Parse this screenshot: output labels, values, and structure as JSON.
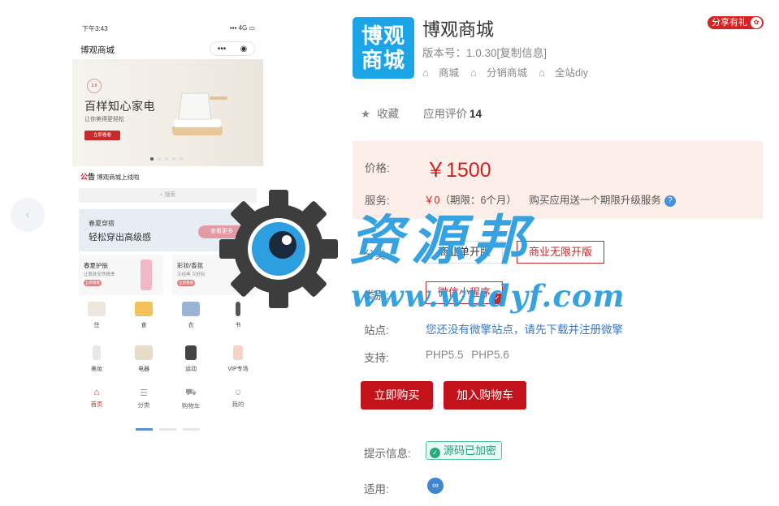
{
  "preview": {
    "status_time": "下午3:43",
    "status_signal": "4G",
    "phone_title": "博观商城",
    "capsule_menu": "•••",
    "banner_badge": "3.8",
    "banner_title": "百样知心家电",
    "banner_subtitle": "让你美得更轻松",
    "banner_button": "立即看看",
    "notice_prefix_a": "公",
    "notice_prefix_b": "告",
    "notice_text": "博观商城上线啦",
    "search_placeholder": "搜索",
    "promo_line1": "春夏穿搭",
    "promo_line2": "轻松穿出高级感",
    "promo_button": "查看更多",
    "cards": [
      {
        "title": "春夏护肤",
        "subtitle": "让肌肤安然换季",
        "button": "立即看看"
      },
      {
        "title": "彩妆/香氛",
        "subtitle": "又经典 又好玩",
        "button": "立即看看"
      }
    ],
    "categories": [
      "住",
      "食",
      "衣",
      "书",
      "美妆",
      "电器",
      "运动",
      "VIP专场"
    ],
    "tabs": [
      "首页",
      "分类",
      "购物车",
      "我的"
    ]
  },
  "app": {
    "logo_line1": "博观",
    "logo_line2": "商城",
    "name": "博观商城",
    "version": "版本号：1.0.30[复制信息]",
    "tags": [
      "商城",
      "分销商城",
      "全站diy"
    ],
    "share_label": "分享有礼",
    "favorite_label": "收藏",
    "rating_label": "应用评价",
    "rating_count": "14"
  },
  "pricing": {
    "price_label": "价格:",
    "price": "￥1500",
    "service_label": "服务:",
    "service_price": "￥0",
    "service_period": "（期限：6个月）",
    "service_desc": "购买应用送一个期限升级服务",
    "help_icon": "?"
  },
  "options": {
    "edition_label": "分类:",
    "editions": [
      "商业单开版",
      "商业无限开版"
    ],
    "selected_edition": "商业无限开版",
    "type_label": "类别:",
    "types": [
      "微信小程序"
    ],
    "selected_type": "微信小程序"
  },
  "site": {
    "label": "站点:",
    "link_text": "您还没有微擎站点，请先下载并注册微擎"
  },
  "support": {
    "label": "支持:",
    "value": "PHP5.5   PHP5.6"
  },
  "actions": {
    "buy_now": "立即购买",
    "add_to_cart": "加入购物车"
  },
  "notice": {
    "label": "提示信息:",
    "badge": "源码已加密"
  },
  "apply": {
    "label": "适用:",
    "icon": "miniprogram-icon"
  },
  "watermark": {
    "text_cn": "资源邦",
    "text_url": "www.wudyf.com"
  },
  "colors": {
    "accent_red": "#c4121a",
    "logo_blue": "#1ba4e6",
    "link_blue": "#3a78c4",
    "price_bg": "#fdeee9"
  }
}
